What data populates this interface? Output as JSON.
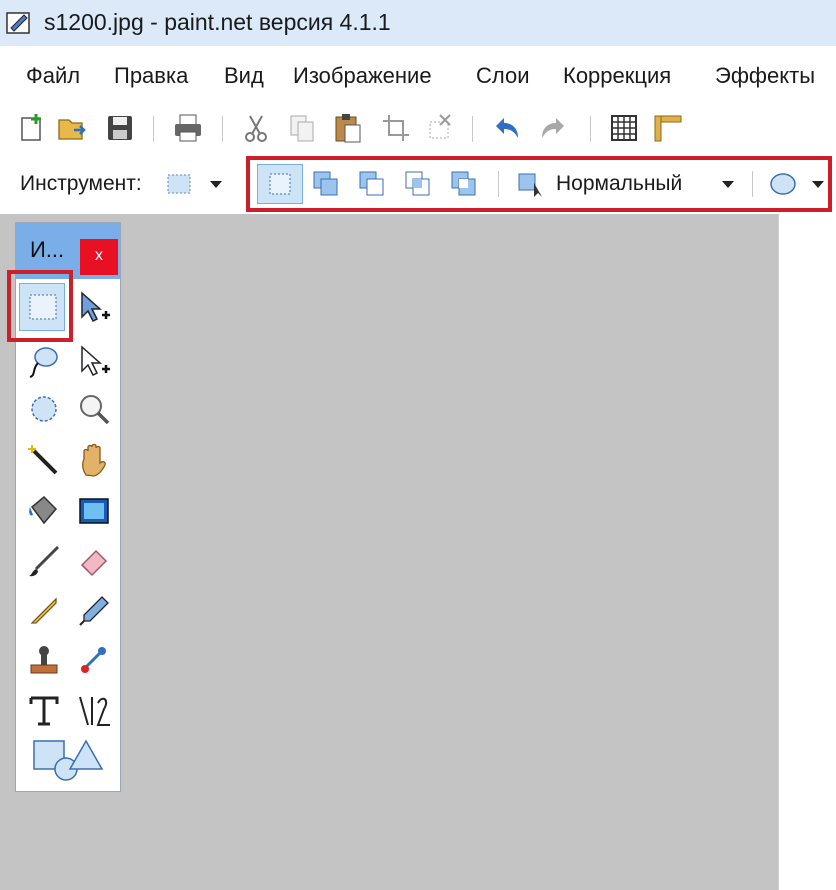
{
  "window": {
    "title": "s1200.jpg - paint.net версия 4.1.1"
  },
  "menu": [
    "Файл",
    "Правка",
    "Вид",
    "Изображение",
    "Слои",
    "Коррекция",
    "Эффекты"
  ],
  "toolbar_icons": [
    "new-image-icon",
    "open-icon",
    "save-icon",
    "print-icon",
    "cut-icon",
    "copy-icon",
    "paste-icon",
    "crop-icon",
    "deselect-icon",
    "undo-icon",
    "redo-icon",
    "grid-icon",
    "ruler-icon"
  ],
  "tool_options": {
    "label": "Инструмент:",
    "selection_modes": [
      "replace-mode-icon",
      "union-mode-icon",
      "exclude-mode-icon",
      "intersect-mode-icon",
      "invert-mode-icon"
    ],
    "mode_value": "Нормальный"
  },
  "tools_window": {
    "title": "И...",
    "close": "x",
    "tools": [
      "rectangle-select-icon",
      "move-selection-icon",
      "lasso-select-icon",
      "move-selected-icon",
      "ellipse-select-icon",
      "zoom-icon",
      "magic-wand-icon",
      "pan-icon",
      "paint-bucket-icon",
      "gradient-icon",
      "paintbrush-icon",
      "eraser-icon",
      "pencil-icon",
      "color-picker-icon",
      "clone-stamp-icon",
      "recolor-icon",
      "text-icon",
      "line-curve-icon",
      "shapes-icon"
    ]
  },
  "colors": {
    "title_bg": "#dbe9f9",
    "highlight": "#cc1f2a",
    "canvas": "#c4c4c4",
    "tools_header": "#7aaee8",
    "close": "#e81123"
  }
}
